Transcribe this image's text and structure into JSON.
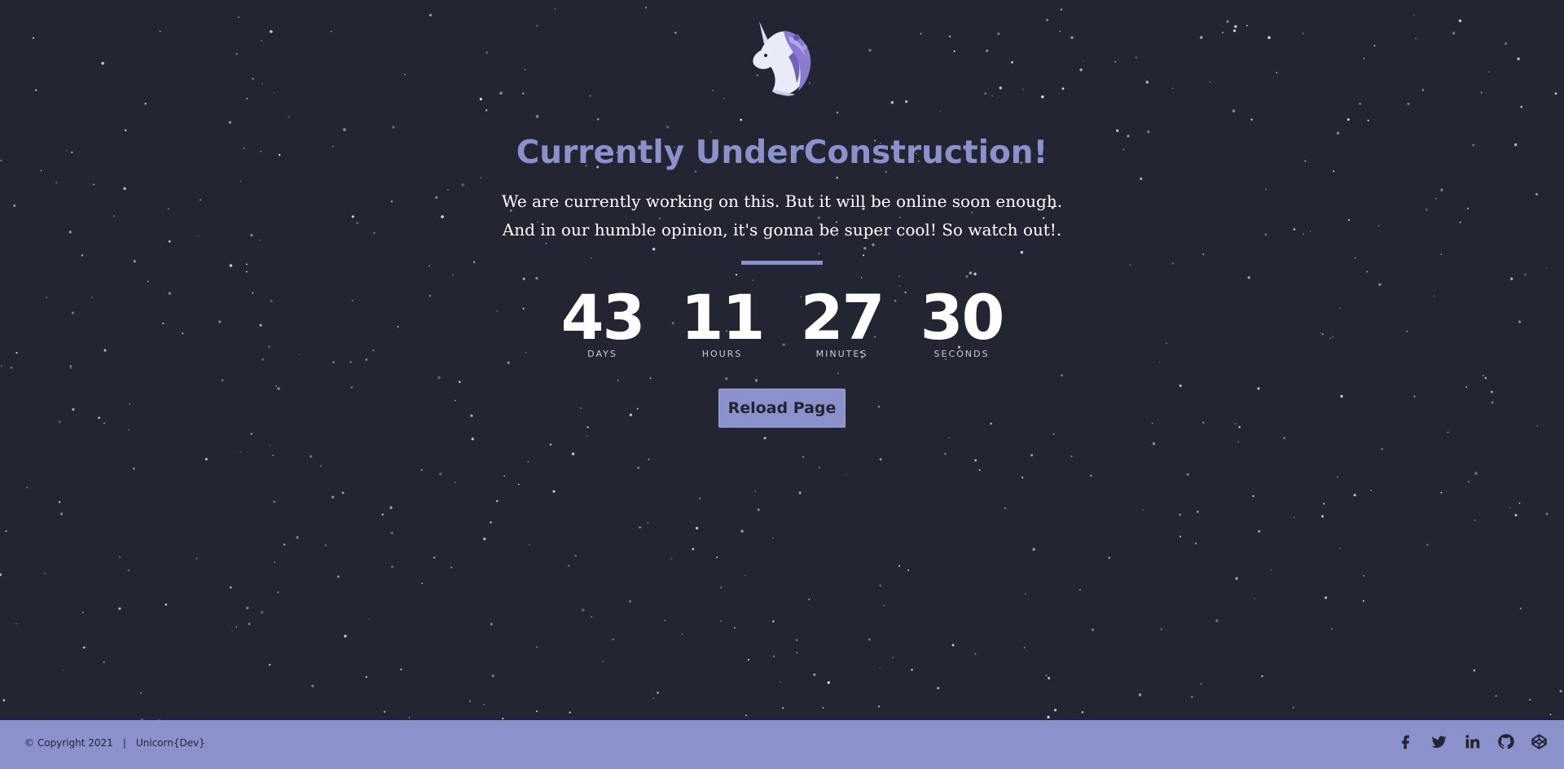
{
  "page": {
    "logo_name": "unicorn-logo",
    "title": "Currently UnderConstruction!",
    "subtitle_line1": "We are currently working on this. But it will be online soon enough.",
    "subtitle_line2": "And in our humble opinion, it's gonna be super cool! So watch out!."
  },
  "countdown": [
    {
      "value": "43",
      "label": "DAYS"
    },
    {
      "value": "11",
      "label": "HOURS"
    },
    {
      "value": "27",
      "label": "MINUTES"
    },
    {
      "value": "30",
      "label": "SECONDS"
    }
  ],
  "actions": {
    "reload_label": "Reload Page"
  },
  "footer": {
    "copyright": "© Copyright 2021",
    "separator": "|",
    "brand": "Unicorn{Dev}",
    "social": [
      {
        "name": "facebook-icon"
      },
      {
        "name": "twitter-icon"
      },
      {
        "name": "linkedin-icon"
      },
      {
        "name": "github-icon"
      },
      {
        "name": "codepen-icon"
      }
    ]
  },
  "colors": {
    "background": "#232533",
    "accent": "#8a91cb",
    "text": "#ffffff"
  }
}
